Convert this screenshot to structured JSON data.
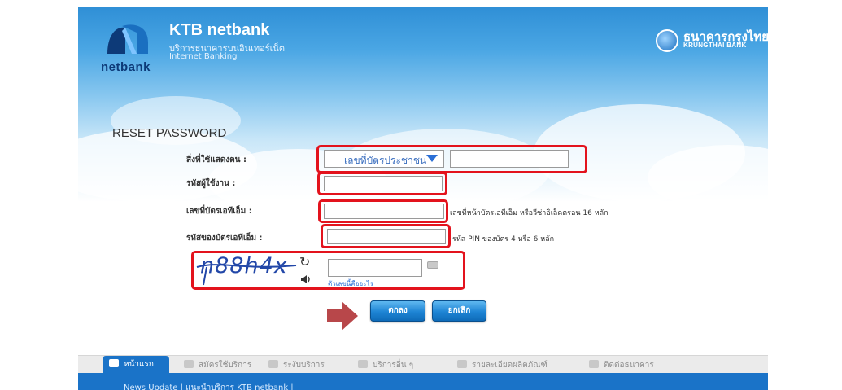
{
  "header": {
    "logo_text": "netbank",
    "brand_title": "KTB netbank",
    "brand_subtitle_th": "บริการธนาคารบนอินเทอร์เน็ต",
    "brand_subtitle_en": "Internet Banking",
    "bank_name_th": "ธนาคารกรุงไทย",
    "bank_name_en": "KRUNGTHAI BANK"
  },
  "form": {
    "title": "RESET PASSWORD",
    "id_type_label": "สิ่งที่ใช้แสดงตน :",
    "id_type_selected": "เลขที่บัตรประชาชน",
    "id_number_value": "",
    "username_label": "รหัสผู้ใช้งาน :",
    "username_value": "",
    "atm_card_label": "เลขที่บัตรเอทีเอ็ม :",
    "atm_card_value": "",
    "atm_card_hint": "เลขที่หน้าบัตรเอทีเอ็ม หรือวีซ่าอิเล็คตรอน 16 หลัก",
    "atm_pin_label": "รหัสของบัตรเอทีเอ็ม :",
    "atm_pin_value": "",
    "atm_pin_hint": "รหัส PIN ของบัตร 4 หรือ 6 หลัก",
    "captcha_text": "n88h4x",
    "captcha_value": "",
    "captcha_help": "ตัวเลขนี้คืออะไร",
    "ok_label": "ตกลง",
    "cancel_label": "ยกเลิก"
  },
  "nav": {
    "items": [
      "หน้าแรก",
      "สมัครใช้บริการ",
      "ระงับบริการ",
      "บริการอื่น ๆ",
      "รายละเอียดผลิตภัณฑ์",
      "ติดต่อธนาคาร"
    ]
  },
  "footer": {
    "links": "News Update   |   แนะนำบริการ KTB netbank   |"
  },
  "colors": {
    "highlight": "#e3131d",
    "button": "#1e84d4",
    "nav_active": "#1a73c8",
    "arrow": "#b8474a"
  }
}
